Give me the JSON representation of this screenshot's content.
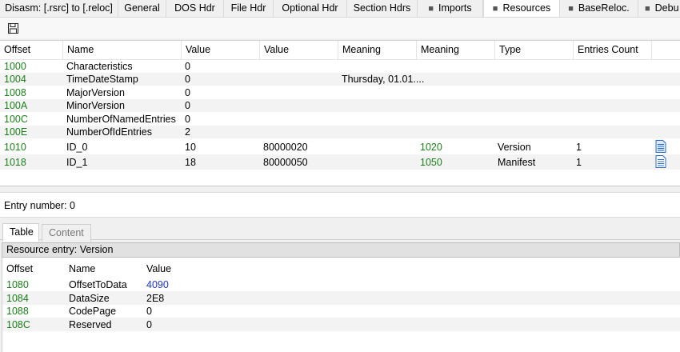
{
  "tabs": [
    {
      "label": "Disasm: [.rsrc] to [.reloc]",
      "icon": ""
    },
    {
      "label": "General",
      "icon": ""
    },
    {
      "label": "DOS Hdr",
      "icon": ""
    },
    {
      "label": "File Hdr",
      "icon": ""
    },
    {
      "label": "Optional Hdr",
      "icon": ""
    },
    {
      "label": "Section Hdrs",
      "icon": ""
    },
    {
      "label": "Imports",
      "icon": "folder-icon"
    },
    {
      "label": "Resources",
      "icon": "folder-icon"
    },
    {
      "label": "BaseReloc.",
      "icon": "folder-icon"
    },
    {
      "label": "Debu",
      "icon": "folder-icon"
    }
  ],
  "active_tab": "Resources",
  "toolbar": {
    "save_icon": "save-icon"
  },
  "top_table": {
    "columns": [
      "Offset",
      "Name",
      "Value",
      "Value",
      "Meaning",
      "Meaning",
      "Type",
      "Entries Count"
    ],
    "rows": [
      {
        "offset": "1000",
        "name": "Characteristics",
        "value": "0",
        "value2": "",
        "meaning": "",
        "meaning2": "",
        "type": "",
        "entries": "",
        "icon": ""
      },
      {
        "offset": "1004",
        "name": "TimeDateStamp",
        "value": "0",
        "value2": "",
        "meaning": "Thursday, 01.01....",
        "meaning2": "",
        "type": "",
        "entries": "",
        "icon": ""
      },
      {
        "offset": "1008",
        "name": "MajorVersion",
        "value": "0",
        "value2": "",
        "meaning": "",
        "meaning2": "",
        "type": "",
        "entries": "",
        "icon": ""
      },
      {
        "offset": "100A",
        "name": "MinorVersion",
        "value": "0",
        "value2": "",
        "meaning": "",
        "meaning2": "",
        "type": "",
        "entries": "",
        "icon": ""
      },
      {
        "offset": "100C",
        "name": "NumberOfNamedEntries",
        "value": "0",
        "value2": "",
        "meaning": "",
        "meaning2": "",
        "type": "",
        "entries": "",
        "icon": ""
      },
      {
        "offset": "100E",
        "name": "NumberOfIdEntries",
        "value": "2",
        "value2": "",
        "meaning": "",
        "meaning2": "",
        "type": "",
        "entries": "",
        "icon": ""
      },
      {
        "offset": "1010",
        "name": "ID_0",
        "value": "10",
        "value2": "80000020",
        "meaning": "",
        "meaning2": "1020",
        "type": "Version",
        "entries": "1",
        "icon": "document-icon"
      },
      {
        "offset": "1018",
        "name": "ID_1",
        "value": "18",
        "value2": "80000050",
        "meaning": "",
        "meaning2": "1050",
        "type": "Manifest",
        "entries": "1",
        "icon": "document-icon"
      }
    ]
  },
  "status": {
    "text": "Entry number: 0"
  },
  "lower_tabs": [
    {
      "label": "Table"
    },
    {
      "label": "Content"
    }
  ],
  "entry": {
    "title": "Resource entry: Version",
    "columns": [
      "Offset",
      "Name",
      "Value"
    ],
    "rows": [
      {
        "offset": "1080",
        "name": "OffsetToData",
        "value": "4090",
        "value_link": true
      },
      {
        "offset": "1084",
        "name": "DataSize",
        "value": "2E8",
        "value_link": false
      },
      {
        "offset": "1088",
        "name": "CodePage",
        "value": "0",
        "value_link": false
      },
      {
        "offset": "108C",
        "name": "Reserved",
        "value": "0",
        "value_link": false
      }
    ]
  },
  "colors": {
    "offset_green": "#1a7f1a",
    "link_blue": "#1f35c9",
    "doc_blue": "#2b6cc4"
  }
}
